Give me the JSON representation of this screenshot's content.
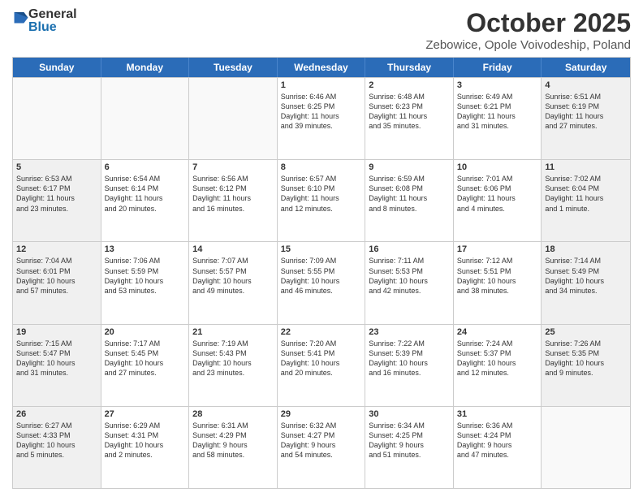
{
  "logo": {
    "general": "General",
    "blue": "Blue"
  },
  "title": "October 2025",
  "location": "Zebowice, Opole Voivodeship, Poland",
  "days_of_week": [
    "Sunday",
    "Monday",
    "Tuesday",
    "Wednesday",
    "Thursday",
    "Friday",
    "Saturday"
  ],
  "rows": [
    [
      {
        "day": "",
        "info": ""
      },
      {
        "day": "",
        "info": ""
      },
      {
        "day": "",
        "info": ""
      },
      {
        "day": "1",
        "info": "Sunrise: 6:46 AM\nSunset: 6:25 PM\nDaylight: 11 hours\nand 39 minutes."
      },
      {
        "day": "2",
        "info": "Sunrise: 6:48 AM\nSunset: 6:23 PM\nDaylight: 11 hours\nand 35 minutes."
      },
      {
        "day": "3",
        "info": "Sunrise: 6:49 AM\nSunset: 6:21 PM\nDaylight: 11 hours\nand 31 minutes."
      },
      {
        "day": "4",
        "info": "Sunrise: 6:51 AM\nSunset: 6:19 PM\nDaylight: 11 hours\nand 27 minutes."
      }
    ],
    [
      {
        "day": "5",
        "info": "Sunrise: 6:53 AM\nSunset: 6:17 PM\nDaylight: 11 hours\nand 23 minutes."
      },
      {
        "day": "6",
        "info": "Sunrise: 6:54 AM\nSunset: 6:14 PM\nDaylight: 11 hours\nand 20 minutes."
      },
      {
        "day": "7",
        "info": "Sunrise: 6:56 AM\nSunset: 6:12 PM\nDaylight: 11 hours\nand 16 minutes."
      },
      {
        "day": "8",
        "info": "Sunrise: 6:57 AM\nSunset: 6:10 PM\nDaylight: 11 hours\nand 12 minutes."
      },
      {
        "day": "9",
        "info": "Sunrise: 6:59 AM\nSunset: 6:08 PM\nDaylight: 11 hours\nand 8 minutes."
      },
      {
        "day": "10",
        "info": "Sunrise: 7:01 AM\nSunset: 6:06 PM\nDaylight: 11 hours\nand 4 minutes."
      },
      {
        "day": "11",
        "info": "Sunrise: 7:02 AM\nSunset: 6:04 PM\nDaylight: 11 hours\nand 1 minute."
      }
    ],
    [
      {
        "day": "12",
        "info": "Sunrise: 7:04 AM\nSunset: 6:01 PM\nDaylight: 10 hours\nand 57 minutes."
      },
      {
        "day": "13",
        "info": "Sunrise: 7:06 AM\nSunset: 5:59 PM\nDaylight: 10 hours\nand 53 minutes."
      },
      {
        "day": "14",
        "info": "Sunrise: 7:07 AM\nSunset: 5:57 PM\nDaylight: 10 hours\nand 49 minutes."
      },
      {
        "day": "15",
        "info": "Sunrise: 7:09 AM\nSunset: 5:55 PM\nDaylight: 10 hours\nand 46 minutes."
      },
      {
        "day": "16",
        "info": "Sunrise: 7:11 AM\nSunset: 5:53 PM\nDaylight: 10 hours\nand 42 minutes."
      },
      {
        "day": "17",
        "info": "Sunrise: 7:12 AM\nSunset: 5:51 PM\nDaylight: 10 hours\nand 38 minutes."
      },
      {
        "day": "18",
        "info": "Sunrise: 7:14 AM\nSunset: 5:49 PM\nDaylight: 10 hours\nand 34 minutes."
      }
    ],
    [
      {
        "day": "19",
        "info": "Sunrise: 7:15 AM\nSunset: 5:47 PM\nDaylight: 10 hours\nand 31 minutes."
      },
      {
        "day": "20",
        "info": "Sunrise: 7:17 AM\nSunset: 5:45 PM\nDaylight: 10 hours\nand 27 minutes."
      },
      {
        "day": "21",
        "info": "Sunrise: 7:19 AM\nSunset: 5:43 PM\nDaylight: 10 hours\nand 23 minutes."
      },
      {
        "day": "22",
        "info": "Sunrise: 7:20 AM\nSunset: 5:41 PM\nDaylight: 10 hours\nand 20 minutes."
      },
      {
        "day": "23",
        "info": "Sunrise: 7:22 AM\nSunset: 5:39 PM\nDaylight: 10 hours\nand 16 minutes."
      },
      {
        "day": "24",
        "info": "Sunrise: 7:24 AM\nSunset: 5:37 PM\nDaylight: 10 hours\nand 12 minutes."
      },
      {
        "day": "25",
        "info": "Sunrise: 7:26 AM\nSunset: 5:35 PM\nDaylight: 10 hours\nand 9 minutes."
      }
    ],
    [
      {
        "day": "26",
        "info": "Sunrise: 6:27 AM\nSunset: 4:33 PM\nDaylight: 10 hours\nand 5 minutes."
      },
      {
        "day": "27",
        "info": "Sunrise: 6:29 AM\nSunset: 4:31 PM\nDaylight: 10 hours\nand 2 minutes."
      },
      {
        "day": "28",
        "info": "Sunrise: 6:31 AM\nSunset: 4:29 PM\nDaylight: 9 hours\nand 58 minutes."
      },
      {
        "day": "29",
        "info": "Sunrise: 6:32 AM\nSunset: 4:27 PM\nDaylight: 9 hours\nand 54 minutes."
      },
      {
        "day": "30",
        "info": "Sunrise: 6:34 AM\nSunset: 4:25 PM\nDaylight: 9 hours\nand 51 minutes."
      },
      {
        "day": "31",
        "info": "Sunrise: 6:36 AM\nSunset: 4:24 PM\nDaylight: 9 hours\nand 47 minutes."
      },
      {
        "day": "",
        "info": ""
      }
    ]
  ]
}
